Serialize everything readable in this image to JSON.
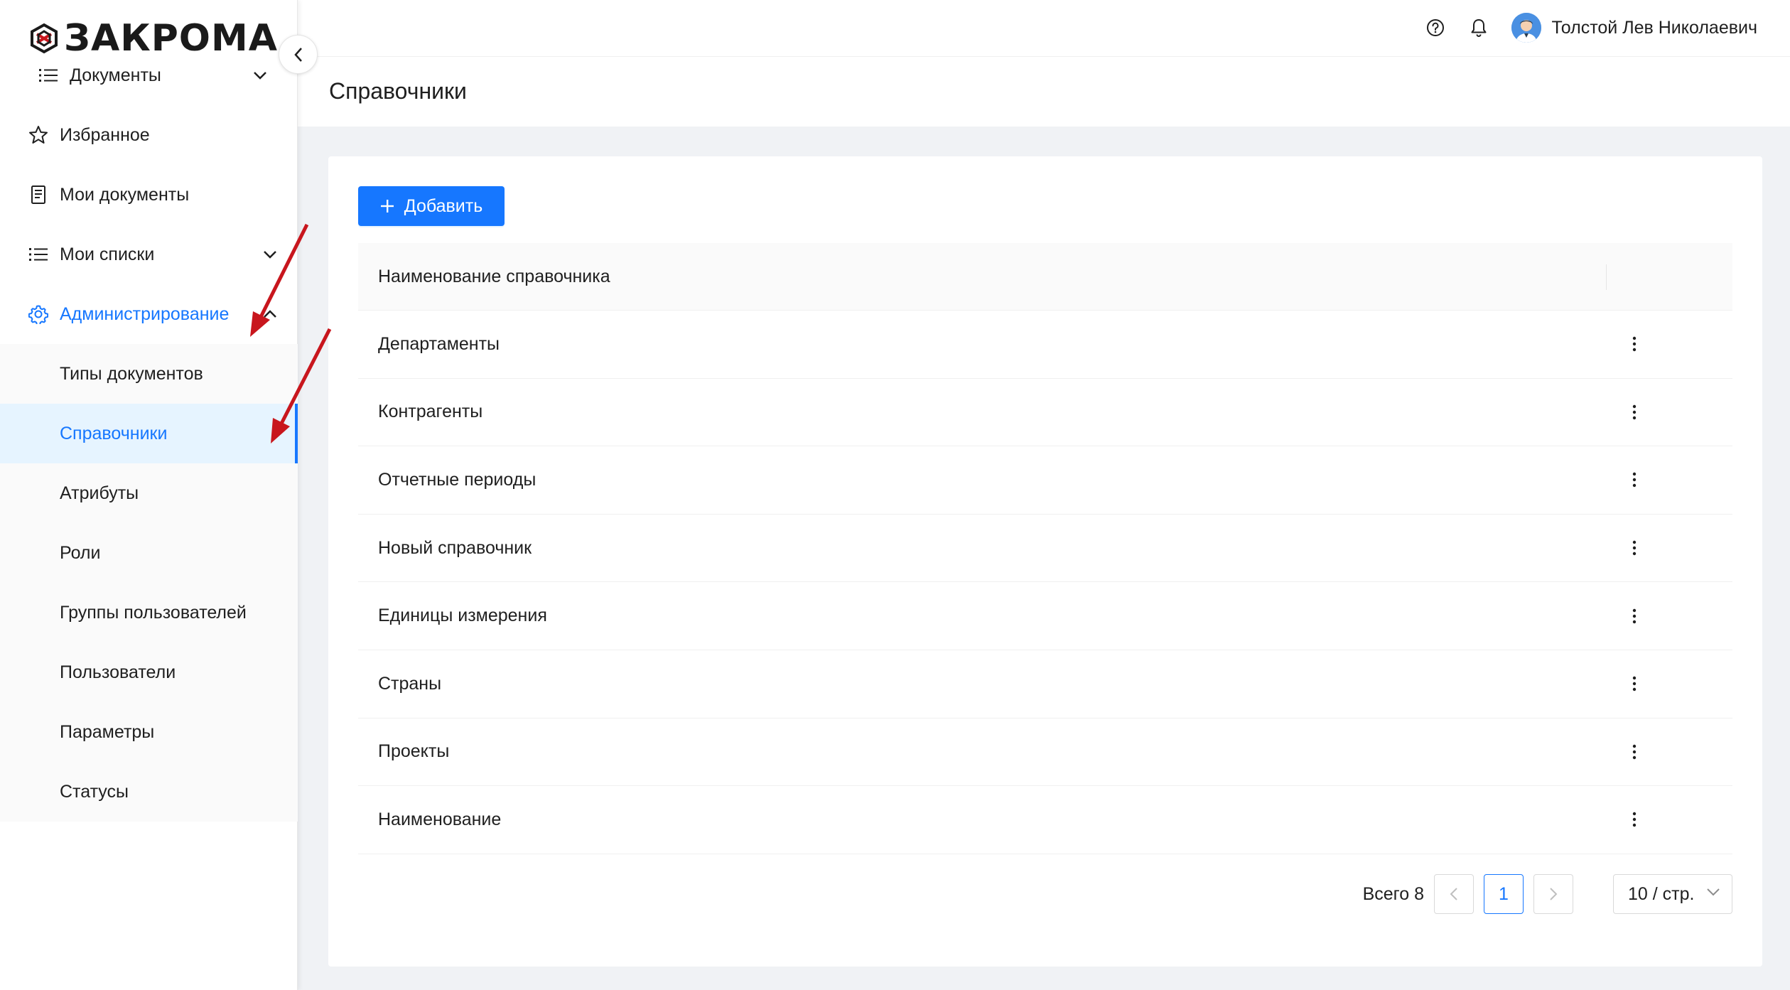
{
  "app": {
    "logo_text": "ЗАКРОМА"
  },
  "header": {
    "user_name": "Толстой Лев Николаевич",
    "help_icon": "help-circle-icon",
    "bell_icon": "bell-icon"
  },
  "sidebar": {
    "top_items": [
      {
        "label": "Документы",
        "icon": "list-icon",
        "has_chevron": true
      },
      {
        "label": "Избранное",
        "icon": "star-icon"
      },
      {
        "label": "Мои документы",
        "icon": "document-icon"
      },
      {
        "label": "Мои списки",
        "icon": "list-icon",
        "has_chevron": true
      }
    ],
    "admin": {
      "label": "Администрирование",
      "icon": "gear-icon"
    },
    "sub_items": [
      {
        "label": "Типы документов"
      },
      {
        "label": "Справочники",
        "selected": true
      },
      {
        "label": "Атрибуты"
      },
      {
        "label": "Роли"
      },
      {
        "label": "Группы пользователей"
      },
      {
        "label": "Пользователи"
      },
      {
        "label": "Параметры"
      },
      {
        "label": "Статусы"
      }
    ]
  },
  "page": {
    "title": "Справочники"
  },
  "toolbar": {
    "add_label": "Добавить"
  },
  "table": {
    "header": "Наименование справочника",
    "rows": [
      "Департаменты",
      "Контрагенты",
      "Отчетные периоды",
      "Новый справочник",
      "Единицы измерения",
      "Страны",
      "Проекты",
      "Наименование"
    ]
  },
  "pagination": {
    "total_label": "Всего 8",
    "current_page": "1",
    "page_size": "10 / стр."
  },
  "colors": {
    "primary": "#1677ff",
    "annotation_arrow": "#c8161d"
  }
}
